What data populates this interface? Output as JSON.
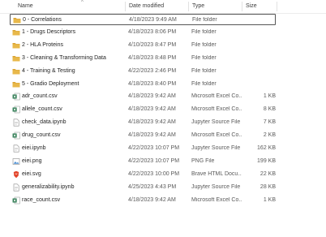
{
  "columns": {
    "name": "Name",
    "date": "Date modified",
    "type": "Type",
    "size": "Size"
  },
  "files": [
    {
      "name": "0 - Correlations",
      "date": "4/18/2023 9:49 AM",
      "type": "File folder",
      "size": "",
      "icon": "folder-icon",
      "selected": true
    },
    {
      "name": "1 - Drugs Descriptors",
      "date": "4/18/2023 8:06 PM",
      "type": "File folder",
      "size": "",
      "icon": "folder-icon"
    },
    {
      "name": "2 - HLA Proteins",
      "date": "4/10/2023 8:47 PM",
      "type": "File folder",
      "size": "",
      "icon": "folder-icon"
    },
    {
      "name": "3 - Cleaning & Transforming Data",
      "date": "4/18/2023 8:48 PM",
      "type": "File folder",
      "size": "",
      "icon": "folder-icon"
    },
    {
      "name": "4 - Training & Testing",
      "date": "4/22/2023 2:46 PM",
      "type": "File folder",
      "size": "",
      "icon": "folder-icon"
    },
    {
      "name": "5 - Gradio Deployment",
      "date": "4/18/2023 8:40 PM",
      "type": "File folder",
      "size": "",
      "icon": "folder-icon"
    },
    {
      "name": "adr_count.csv",
      "date": "4/18/2023 9:42 AM",
      "type": "Microsoft Excel Co...",
      "size": "1 KB",
      "icon": "excel-icon"
    },
    {
      "name": "allele_count.csv",
      "date": "4/18/2023 9:42 AM",
      "type": "Microsoft Excel Co...",
      "size": "8 KB",
      "icon": "excel-icon"
    },
    {
      "name": "check_data.ipynb",
      "date": "4/18/2023 9:42 AM",
      "type": "Jupyter Source File",
      "size": "7 KB",
      "icon": "document-icon"
    },
    {
      "name": "drug_count.csv",
      "date": "4/18/2023 9:42 AM",
      "type": "Microsoft Excel Co...",
      "size": "2 KB",
      "icon": "excel-icon"
    },
    {
      "name": "eiei.ipynb",
      "date": "4/22/2023 10:07 PM",
      "type": "Jupyter Source File",
      "size": "162 KB",
      "icon": "document-icon"
    },
    {
      "name": "eiei.png",
      "date": "4/22/2023 10:07 PM",
      "type": "PNG File",
      "size": "199 KB",
      "icon": "image-icon"
    },
    {
      "name": "eiei.svg",
      "date": "4/22/2023 10:00 PM",
      "type": "Brave HTML Docu...",
      "size": "22 KB",
      "icon": "brave-icon"
    },
    {
      "name": "generalizability.ipynb",
      "date": "4/25/2023 4:43 PM",
      "type": "Jupyter Source File",
      "size": "28 KB",
      "icon": "document-icon"
    },
    {
      "name": "race_count.csv",
      "date": "4/18/2023 9:42 AM",
      "type": "Microsoft Excel Co...",
      "size": "1 KB",
      "icon": "excel-icon"
    }
  ],
  "colors": {
    "folder": "#e8b84a",
    "folder_tab": "#d9a233",
    "excel": "#1e7145",
    "brave": "#e2452b",
    "image": "#4a8fd4",
    "selection_border": "#555555"
  }
}
